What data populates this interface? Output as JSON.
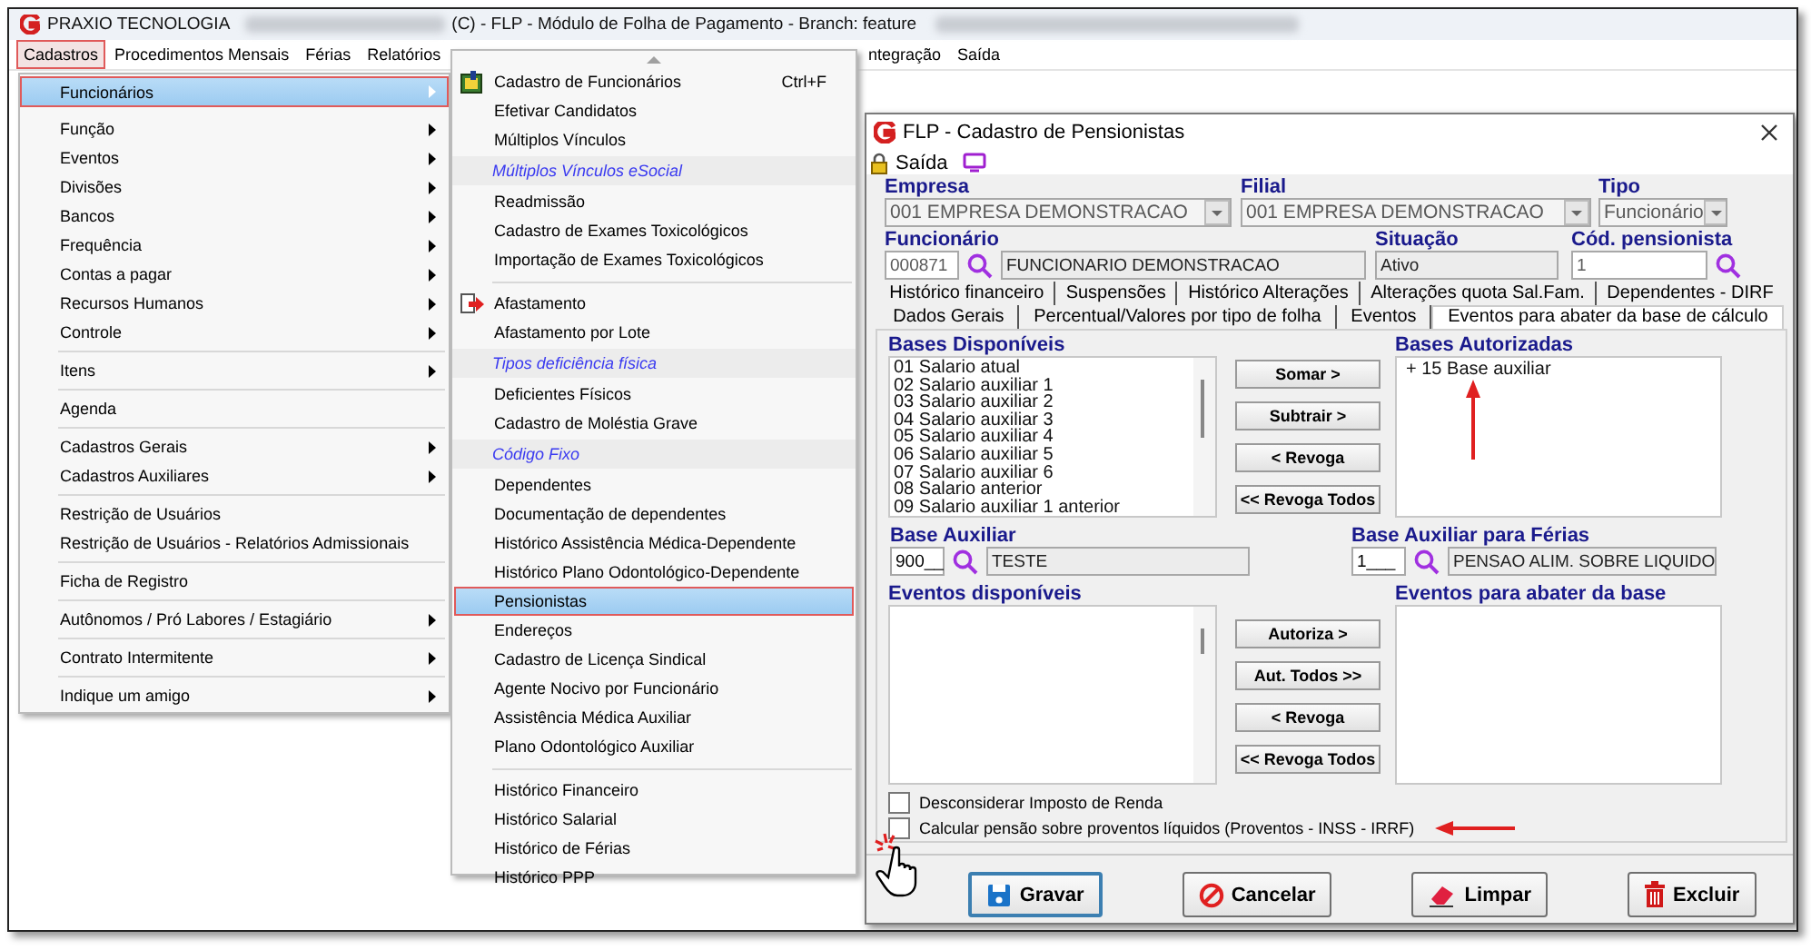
{
  "app": {
    "brand": "PRAXIO TECNOLOGIA",
    "title": "(C) - FLP - Módulo de Folha de Pagamento - Branch: feature",
    "menu": [
      {
        "label": "Cadastros",
        "selected": true
      },
      {
        "label": "Procedimentos Mensais",
        "selected": false
      },
      {
        "label": "Férias",
        "selected": false
      },
      {
        "label": "Relatórios",
        "selected": false
      }
    ],
    "menu_right": [
      {
        "label": "ntegração",
        "selected": false
      },
      {
        "label": "Saída",
        "selected": false
      }
    ]
  },
  "main_menu": {
    "items": [
      {
        "kind": "item",
        "label": "Funcionários",
        "has_submenu": true,
        "selected": true
      },
      {
        "kind": "item",
        "label": "Função",
        "has_submenu": true,
        "selected": false
      },
      {
        "kind": "item",
        "label": "Eventos",
        "has_submenu": true,
        "selected": false
      },
      {
        "kind": "item",
        "label": "Divisões",
        "has_submenu": true,
        "selected": false
      },
      {
        "kind": "item",
        "label": "Bancos",
        "has_submenu": true,
        "selected": false
      },
      {
        "kind": "item",
        "label": "Frequência",
        "has_submenu": true,
        "selected": false
      },
      {
        "kind": "item",
        "label": "Contas a pagar",
        "has_submenu": true,
        "selected": false
      },
      {
        "kind": "item",
        "label": "Recursos Humanos",
        "has_submenu": true,
        "selected": false
      },
      {
        "kind": "item",
        "label": "Controle",
        "has_submenu": true,
        "selected": false
      },
      {
        "kind": "separator"
      },
      {
        "kind": "item",
        "label": "Itens",
        "has_submenu": true,
        "selected": false
      },
      {
        "kind": "separator"
      },
      {
        "kind": "item",
        "label": "Agenda",
        "has_submenu": false,
        "selected": false
      },
      {
        "kind": "separator"
      },
      {
        "kind": "item",
        "label": "Cadastros Gerais",
        "has_submenu": true,
        "selected": false
      },
      {
        "kind": "item",
        "label": "Cadastros Auxiliares",
        "has_submenu": true,
        "selected": false
      },
      {
        "kind": "separator"
      },
      {
        "kind": "item",
        "label": "Restrição de Usuários",
        "has_submenu": false,
        "selected": false
      },
      {
        "kind": "item",
        "label": "Restrição de Usuários - Relatórios Admissionais",
        "has_submenu": false,
        "selected": false
      },
      {
        "kind": "separator"
      },
      {
        "kind": "item",
        "label": "Ficha de Registro",
        "has_submenu": false,
        "selected": false
      },
      {
        "kind": "separator"
      },
      {
        "kind": "item",
        "label": "Autônomos / Pró Labores / Estagiário",
        "has_submenu": true,
        "selected": false
      },
      {
        "kind": "separator"
      },
      {
        "kind": "item",
        "label": "Contrato Intermitente",
        "has_submenu": true,
        "selected": false
      },
      {
        "kind": "separator"
      },
      {
        "kind": "item",
        "label": "Indique um amigo",
        "has_submenu": true,
        "selected": false
      }
    ]
  },
  "submenu": {
    "items": [
      {
        "kind": "icon-item",
        "label": "Cadastro de Funcionários",
        "shortcut": "Ctrl+F",
        "selected": false
      },
      {
        "kind": "item",
        "label": "Efetivar Candidatos",
        "selected": false
      },
      {
        "kind": "item",
        "label": "Múltiplos Vínculos",
        "selected": false
      },
      {
        "kind": "header",
        "label": "Múltiplos Vínculos eSocial"
      },
      {
        "kind": "item",
        "label": "Readmissão",
        "selected": false
      },
      {
        "kind": "item",
        "label": "Cadastro de Exames Toxicológicos",
        "selected": false
      },
      {
        "kind": "item",
        "label": "Importação de Exames Toxicológicos",
        "selected": false
      },
      {
        "kind": "separator"
      },
      {
        "kind": "icon-item",
        "label": "Afastamento",
        "selected": false
      },
      {
        "kind": "item",
        "label": "Afastamento por Lote",
        "selected": false
      },
      {
        "kind": "header",
        "label": "Tipos deficiência física"
      },
      {
        "kind": "item",
        "label": "Deficientes Físicos",
        "selected": false
      },
      {
        "kind": "item",
        "label": "Cadastro de Moléstia Grave",
        "selected": false
      },
      {
        "kind": "header",
        "label": "Código Fixo"
      },
      {
        "kind": "item",
        "label": "Dependentes",
        "selected": false
      },
      {
        "kind": "item",
        "label": "Documentação de dependentes",
        "selected": false
      },
      {
        "kind": "item",
        "label": "Histórico Assistência Médica-Dependente",
        "selected": false
      },
      {
        "kind": "item",
        "label": "Histórico Plano Odontológico-Dependente",
        "selected": false
      },
      {
        "kind": "item",
        "label": "Pensionistas",
        "selected": true
      },
      {
        "kind": "item",
        "label": "Endereços",
        "selected": false
      },
      {
        "kind": "item",
        "label": "Cadastro de Licença Sindical",
        "selected": false
      },
      {
        "kind": "item",
        "label": "Agente Nocivo por Funcionário",
        "selected": false
      },
      {
        "kind": "item",
        "label": "Assistência Médica Auxiliar",
        "selected": false
      },
      {
        "kind": "item",
        "label": "Plano Odontológico Auxiliar",
        "selected": false
      },
      {
        "kind": "separator"
      },
      {
        "kind": "item",
        "label": "Histórico Financeiro",
        "selected": false
      },
      {
        "kind": "item",
        "label": "Histórico Salarial",
        "selected": false
      },
      {
        "kind": "item",
        "label": "Histórico de Férias",
        "selected": false
      },
      {
        "kind": "item",
        "label": "Histórico PPP",
        "selected": false
      }
    ]
  },
  "dialog": {
    "title": "FLP - Cadastro de Pensionistas",
    "toolbar_label": "Saída",
    "empresa": {
      "label": "Empresa",
      "value": "001 EMPRESA DEMONSTRACAO"
    },
    "filial": {
      "label": "Filial",
      "value": "001 EMPRESA DEMONSTRACAO"
    },
    "tipo": {
      "label": "Tipo",
      "value": "Funcionário"
    },
    "funcionario": {
      "label": "Funcionário",
      "code": "000871",
      "name": "FUNCIONARIO DEMONSTRACAO"
    },
    "situacao": {
      "label": "Situação",
      "value": "Ativo"
    },
    "cod_pensionista": {
      "label": "Cód. pensionista",
      "value": "1"
    },
    "tab_rows": [
      [
        {
          "label": "Histórico financeiro",
          "selected": false
        },
        {
          "label": "Suspensões",
          "selected": false
        },
        {
          "label": "Histórico Alterações",
          "selected": false
        },
        {
          "label": "Alterações quota Sal.Fam.",
          "selected": false
        },
        {
          "label": "Dependentes - DIRF",
          "selected": false
        }
      ],
      [
        {
          "label": "Dados Gerais",
          "selected": false
        },
        {
          "label": "Percentual/Valores por tipo de folha",
          "selected": false
        },
        {
          "label": "Eventos",
          "selected": false
        },
        {
          "label": "Eventos para abater da base de cálculo",
          "selected": true
        }
      ]
    ],
    "bases_disponiveis": {
      "label": "Bases Disponíveis",
      "items": [
        "01 Salario atual",
        "02 Salario auxiliar 1",
        "03 Salario auxiliar 2",
        "04 Salario auxiliar 3",
        "05 Salario auxiliar 4",
        "06 Salario auxiliar 5",
        "07 Salario auxiliar 6",
        "08 Salario anterior",
        "09 Salario auxiliar 1 anterior"
      ]
    },
    "base_buttons": [
      "Somar >",
      "Subtrair >",
      "< Revoga",
      "<< Revoga Todos"
    ],
    "bases_autorizadas": {
      "label": "Bases Autorizadas",
      "items": [
        "+ 15 Base auxiliar"
      ]
    },
    "base_auxiliar": {
      "label": "Base Auxiliar",
      "code": "900__",
      "name": "TESTE"
    },
    "base_auxiliar_ferias": {
      "label": "Base Auxiliar para Férias",
      "code": "1___",
      "name": "PENSAO ALIM. SOBRE LIQUIDO"
    },
    "eventos_disponiveis": {
      "label": "Eventos disponíveis"
    },
    "evento_buttons": [
      "Autoriza >",
      "Aut. Todos >>",
      "< Revoga",
      "<< Revoga Todos"
    ],
    "eventos_abater": {
      "label": "Eventos para abater da base"
    },
    "checkboxes": [
      {
        "label": "Desconsiderar Imposto de Renda",
        "checked": false
      },
      {
        "label": "Calcular pensão sobre proventos líquidos (Proventos - INSS - IRRF)",
        "checked": false
      }
    ],
    "actions": [
      {
        "label": "Gravar",
        "kind": "save",
        "default": true
      },
      {
        "label": "Cancelar",
        "kind": "cancel",
        "default": false
      },
      {
        "label": "Limpar",
        "kind": "clear",
        "default": false
      },
      {
        "label": "Excluir",
        "kind": "delete",
        "default": false
      }
    ]
  }
}
